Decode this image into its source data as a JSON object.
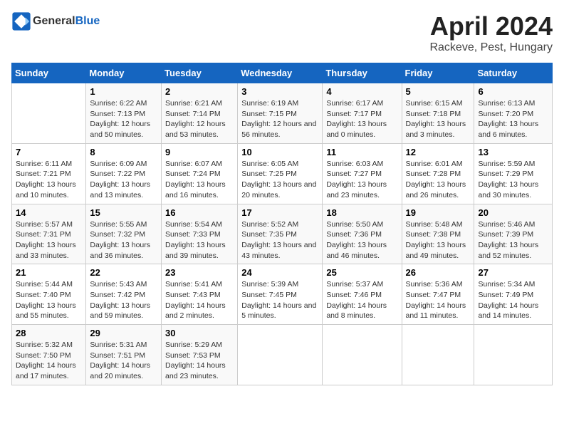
{
  "header": {
    "logo_general": "General",
    "logo_blue": "Blue",
    "title": "April 2024",
    "subtitle": "Rackeve, Pest, Hungary"
  },
  "weekdays": [
    "Sunday",
    "Monday",
    "Tuesday",
    "Wednesday",
    "Thursday",
    "Friday",
    "Saturday"
  ],
  "weeks": [
    [
      {
        "day": "",
        "sunrise": "",
        "sunset": "",
        "daylight": ""
      },
      {
        "day": "1",
        "sunrise": "Sunrise: 6:22 AM",
        "sunset": "Sunset: 7:13 PM",
        "daylight": "Daylight: 12 hours and 50 minutes."
      },
      {
        "day": "2",
        "sunrise": "Sunrise: 6:21 AM",
        "sunset": "Sunset: 7:14 PM",
        "daylight": "Daylight: 12 hours and 53 minutes."
      },
      {
        "day": "3",
        "sunrise": "Sunrise: 6:19 AM",
        "sunset": "Sunset: 7:15 PM",
        "daylight": "Daylight: 12 hours and 56 minutes."
      },
      {
        "day": "4",
        "sunrise": "Sunrise: 6:17 AM",
        "sunset": "Sunset: 7:17 PM",
        "daylight": "Daylight: 13 hours and 0 minutes."
      },
      {
        "day": "5",
        "sunrise": "Sunrise: 6:15 AM",
        "sunset": "Sunset: 7:18 PM",
        "daylight": "Daylight: 13 hours and 3 minutes."
      },
      {
        "day": "6",
        "sunrise": "Sunrise: 6:13 AM",
        "sunset": "Sunset: 7:20 PM",
        "daylight": "Daylight: 13 hours and 6 minutes."
      }
    ],
    [
      {
        "day": "7",
        "sunrise": "Sunrise: 6:11 AM",
        "sunset": "Sunset: 7:21 PM",
        "daylight": "Daylight: 13 hours and 10 minutes."
      },
      {
        "day": "8",
        "sunrise": "Sunrise: 6:09 AM",
        "sunset": "Sunset: 7:22 PM",
        "daylight": "Daylight: 13 hours and 13 minutes."
      },
      {
        "day": "9",
        "sunrise": "Sunrise: 6:07 AM",
        "sunset": "Sunset: 7:24 PM",
        "daylight": "Daylight: 13 hours and 16 minutes."
      },
      {
        "day": "10",
        "sunrise": "Sunrise: 6:05 AM",
        "sunset": "Sunset: 7:25 PM",
        "daylight": "Daylight: 13 hours and 20 minutes."
      },
      {
        "day": "11",
        "sunrise": "Sunrise: 6:03 AM",
        "sunset": "Sunset: 7:27 PM",
        "daylight": "Daylight: 13 hours and 23 minutes."
      },
      {
        "day": "12",
        "sunrise": "Sunrise: 6:01 AM",
        "sunset": "Sunset: 7:28 PM",
        "daylight": "Daylight: 13 hours and 26 minutes."
      },
      {
        "day": "13",
        "sunrise": "Sunrise: 5:59 AM",
        "sunset": "Sunset: 7:29 PM",
        "daylight": "Daylight: 13 hours and 30 minutes."
      }
    ],
    [
      {
        "day": "14",
        "sunrise": "Sunrise: 5:57 AM",
        "sunset": "Sunset: 7:31 PM",
        "daylight": "Daylight: 13 hours and 33 minutes."
      },
      {
        "day": "15",
        "sunrise": "Sunrise: 5:55 AM",
        "sunset": "Sunset: 7:32 PM",
        "daylight": "Daylight: 13 hours and 36 minutes."
      },
      {
        "day": "16",
        "sunrise": "Sunrise: 5:54 AM",
        "sunset": "Sunset: 7:33 PM",
        "daylight": "Daylight: 13 hours and 39 minutes."
      },
      {
        "day": "17",
        "sunrise": "Sunrise: 5:52 AM",
        "sunset": "Sunset: 7:35 PM",
        "daylight": "Daylight: 13 hours and 43 minutes."
      },
      {
        "day": "18",
        "sunrise": "Sunrise: 5:50 AM",
        "sunset": "Sunset: 7:36 PM",
        "daylight": "Daylight: 13 hours and 46 minutes."
      },
      {
        "day": "19",
        "sunrise": "Sunrise: 5:48 AM",
        "sunset": "Sunset: 7:38 PM",
        "daylight": "Daylight: 13 hours and 49 minutes."
      },
      {
        "day": "20",
        "sunrise": "Sunrise: 5:46 AM",
        "sunset": "Sunset: 7:39 PM",
        "daylight": "Daylight: 13 hours and 52 minutes."
      }
    ],
    [
      {
        "day": "21",
        "sunrise": "Sunrise: 5:44 AM",
        "sunset": "Sunset: 7:40 PM",
        "daylight": "Daylight: 13 hours and 55 minutes."
      },
      {
        "day": "22",
        "sunrise": "Sunrise: 5:43 AM",
        "sunset": "Sunset: 7:42 PM",
        "daylight": "Daylight: 13 hours and 59 minutes."
      },
      {
        "day": "23",
        "sunrise": "Sunrise: 5:41 AM",
        "sunset": "Sunset: 7:43 PM",
        "daylight": "Daylight: 14 hours and 2 minutes."
      },
      {
        "day": "24",
        "sunrise": "Sunrise: 5:39 AM",
        "sunset": "Sunset: 7:45 PM",
        "daylight": "Daylight: 14 hours and 5 minutes."
      },
      {
        "day": "25",
        "sunrise": "Sunrise: 5:37 AM",
        "sunset": "Sunset: 7:46 PM",
        "daylight": "Daylight: 14 hours and 8 minutes."
      },
      {
        "day": "26",
        "sunrise": "Sunrise: 5:36 AM",
        "sunset": "Sunset: 7:47 PM",
        "daylight": "Daylight: 14 hours and 11 minutes."
      },
      {
        "day": "27",
        "sunrise": "Sunrise: 5:34 AM",
        "sunset": "Sunset: 7:49 PM",
        "daylight": "Daylight: 14 hours and 14 minutes."
      }
    ],
    [
      {
        "day": "28",
        "sunrise": "Sunrise: 5:32 AM",
        "sunset": "Sunset: 7:50 PM",
        "daylight": "Daylight: 14 hours and 17 minutes."
      },
      {
        "day": "29",
        "sunrise": "Sunrise: 5:31 AM",
        "sunset": "Sunset: 7:51 PM",
        "daylight": "Daylight: 14 hours and 20 minutes."
      },
      {
        "day": "30",
        "sunrise": "Sunrise: 5:29 AM",
        "sunset": "Sunset: 7:53 PM",
        "daylight": "Daylight: 14 hours and 23 minutes."
      },
      {
        "day": "",
        "sunrise": "",
        "sunset": "",
        "daylight": ""
      },
      {
        "day": "",
        "sunrise": "",
        "sunset": "",
        "daylight": ""
      },
      {
        "day": "",
        "sunrise": "",
        "sunset": "",
        "daylight": ""
      },
      {
        "day": "",
        "sunrise": "",
        "sunset": "",
        "daylight": ""
      }
    ]
  ]
}
